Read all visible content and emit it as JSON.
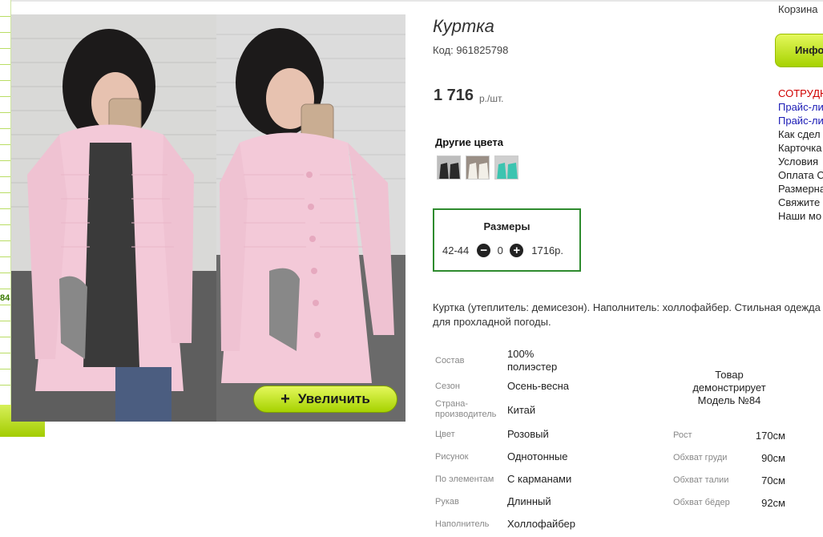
{
  "rail": {
    "number": "84"
  },
  "product": {
    "title": "Куртка",
    "code": "Код: 961825798",
    "price": "1 716",
    "price_unit": "р./шт.",
    "other_colors_label": "Другие цвета",
    "zoom_label": "Увеличить",
    "zoom_icon": "+",
    "swatch_colors": [
      "#2a2a2a",
      "#f2efe8",
      "#3cc4b0"
    ]
  },
  "sizes": {
    "title": "Размеры",
    "size": "42-44",
    "minus_icon": "−",
    "quantity": "0",
    "plus_icon": "+",
    "price": "1716р."
  },
  "description": "Куртка (утеплитель: демисезон). Наполнитель: холлофайбер. Стильная одежда для прохладной погоды.",
  "properties": [
    {
      "key": "Состав",
      "value": "100% полиэстер"
    },
    {
      "key": "Сезон",
      "value": "Осень-весна"
    },
    {
      "key": "Страна-производитель",
      "value": "Китай"
    },
    {
      "key": "Цвет",
      "value": "Розовый"
    },
    {
      "key": "Рисунок",
      "value": "Однотонные"
    },
    {
      "key": "По элементам",
      "value": "С карманами"
    },
    {
      "key": "Рукав",
      "value": "Длинный"
    },
    {
      "key": "Наполнитель",
      "value": "Холлофайбер"
    }
  ],
  "model": {
    "note": "Товар демонстрирует Модель №84",
    "measurements": [
      {
        "key": "Рост",
        "value": "170см"
      },
      {
        "key": "Обхват груди",
        "value": "90см"
      },
      {
        "key": "Обхват талии",
        "value": "70см"
      },
      {
        "key": "Обхват бёдер",
        "value": "92см"
      }
    ]
  },
  "right": {
    "basket": "Корзина",
    "info_button": "Инфо",
    "links": [
      {
        "label": "СОТРУДН",
        "style": "red"
      },
      {
        "label": "Прайс-ли",
        "style": "blue"
      },
      {
        "label": "Прайс-ли",
        "style": "blue"
      },
      {
        "label": "Как сдел",
        "style": "dark"
      },
      {
        "label": "Карточка",
        "style": "dark"
      },
      {
        "label": "Условия",
        "style": "dark"
      },
      {
        "label": "Оплата С",
        "style": "dark"
      },
      {
        "label": "Размерна",
        "style": "dark"
      },
      {
        "label": "Свяжите",
        "style": "dark"
      },
      {
        "label": "Наши мо",
        "style": "dark"
      }
    ]
  },
  "colors": {
    "accent_green": "#a6d200",
    "box_green": "#2e8b2e",
    "link_red": "#d00000",
    "link_blue": "#1a1ab5"
  }
}
